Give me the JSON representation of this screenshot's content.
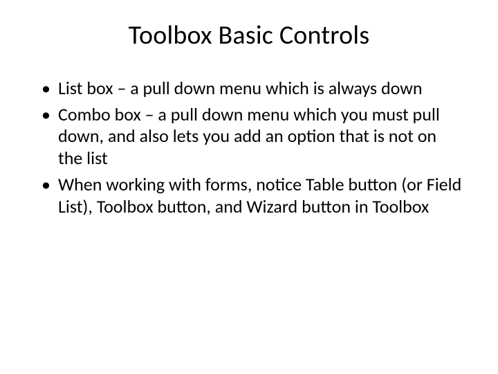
{
  "title": "Toolbox Basic Controls",
  "bullets": [
    "List box – a pull down menu which is always down",
    "Combo box – a pull down menu which you must pull down, and also lets you add an option that is not on the list",
    "When working with forms, notice Table button (or Field List), Toolbox button, and Wizard button in Toolbox"
  ]
}
